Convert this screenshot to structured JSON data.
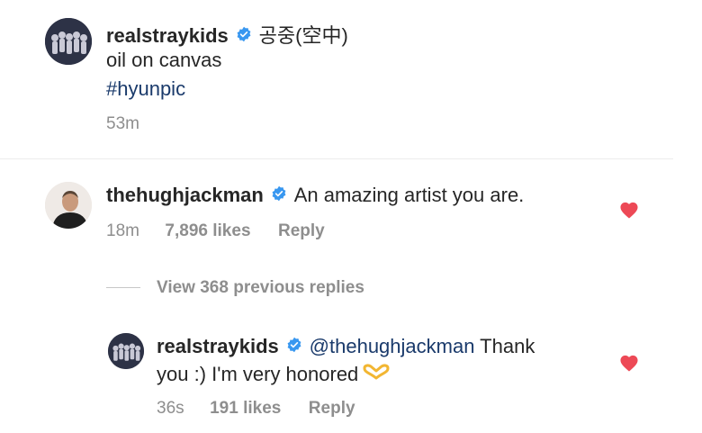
{
  "post": {
    "username": "realstraykids",
    "title_suffix": "공중(空中)",
    "caption": "oil on canvas",
    "hashtag": "#hyunpic",
    "time": "53m"
  },
  "comment": {
    "username": "thehughjackman",
    "text": "An amazing artist you are.",
    "time": "18m",
    "likes": "7,896 likes",
    "reply_label": "Reply"
  },
  "view_replies": "View 368 previous replies",
  "reply": {
    "username": "realstraykids",
    "mention": "@thehughjackman",
    "text_line1_rest": " Thank",
    "text_line2": "you :) I'm very honored",
    "time": "36s",
    "likes": "191 likes",
    "reply_label": "Reply"
  },
  "colors": {
    "verified": "#3897f0",
    "heart": "#ed4956",
    "link": "#1a3a6b"
  },
  "icons": {
    "verified": "verified-badge-icon",
    "heart": "heart-icon",
    "emoji": "heart-hands-emoji"
  }
}
